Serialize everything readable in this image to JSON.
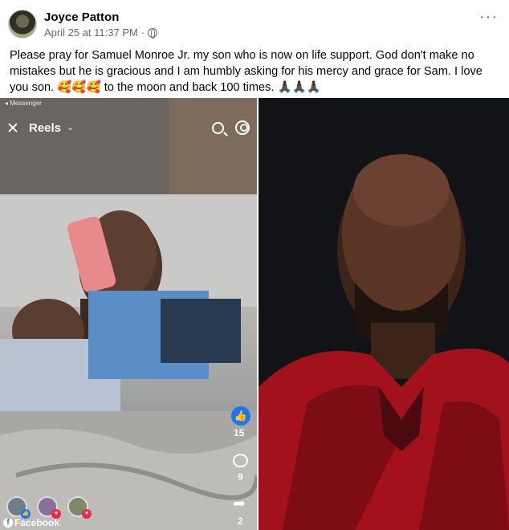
{
  "post": {
    "author": "Joyce Patton",
    "date": "April 25 at 11:37 PM",
    "separator": "·",
    "more_label": "···",
    "text": "Please pray for Samuel Monroe Jr. my son who is now on life support. God don't make no mistakes but he is gracious and I am humbly asking for his mercy and grace for Sam. I love you son. 🥰🥰🥰 to the moon and back 100 times. 🙏🏿🙏🏿🙏🏿"
  },
  "reel": {
    "source_label": "◂ Messenger",
    "title": "Reels",
    "chevron": "⌄",
    "close_glyph": "✕",
    "like_glyph": "👍",
    "like_count": "15",
    "comment_count": "9",
    "share_glyph": "➦",
    "share_count": "2",
    "reaction_badges": [
      "👍",
      "♥",
      "♥"
    ]
  },
  "watermark": {
    "logo_letter": "f",
    "label": "Facebook"
  },
  "colors": {
    "brand_blue": "#1877f2",
    "text_primary": "#050505",
    "text_secondary": "#65676b",
    "love_red": "#f02849"
  }
}
